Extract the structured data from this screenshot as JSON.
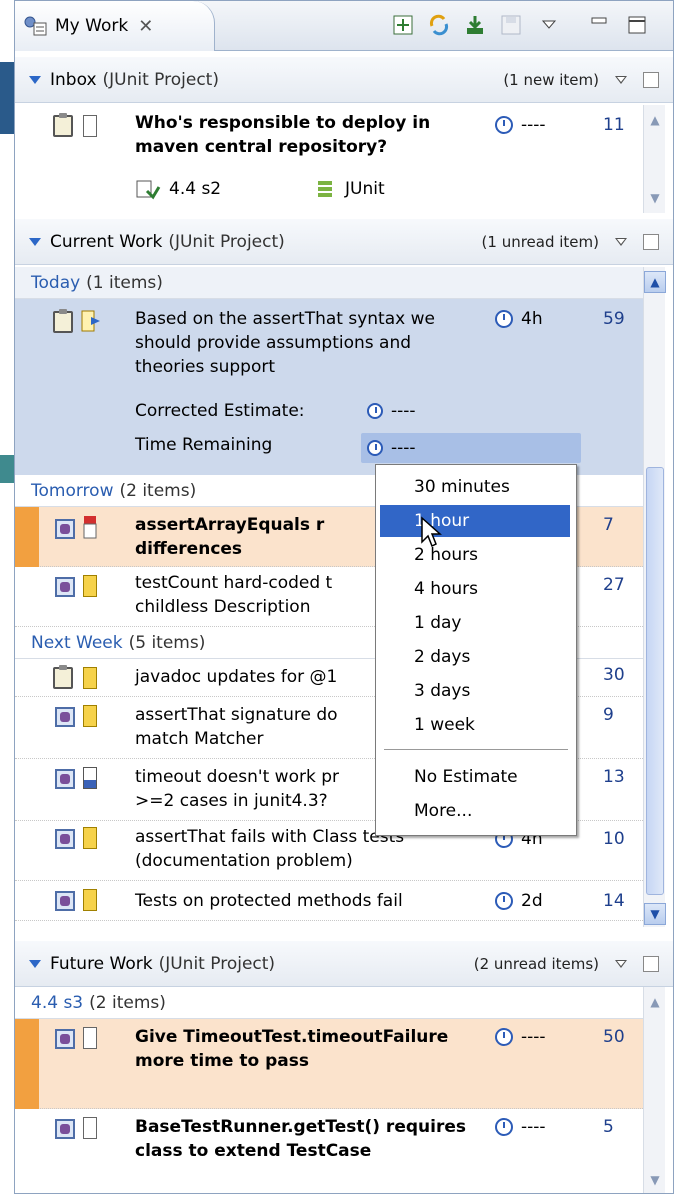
{
  "tab": {
    "label": "My Work"
  },
  "inbox": {
    "title": "Inbox",
    "project": "(JUnit Project)",
    "count": "(1 new item)",
    "row": {
      "text": "Who's responsible to deploy in maven central repository?",
      "schedule": "----",
      "id": "11",
      "release": "4.4 s2",
      "product": "JUnit"
    }
  },
  "current": {
    "title": "Current Work",
    "project": "(JUnit Project)",
    "count": "(1 unread item)",
    "today": {
      "name": "Today",
      "count": "(1 items)",
      "row": {
        "text": "Based on the assertThat syntax we should provide assumptions and theories support",
        "schedule": "4h",
        "id": "59",
        "corrected_label": "Corrected Estimate:",
        "corrected_value": "----",
        "remaining_label": "Time Remaining",
        "remaining_value": "----"
      }
    },
    "tomorrow": {
      "name": "Tomorrow",
      "count": "(2 items)",
      "rows": [
        {
          "text": "assertArrayEquals r differences",
          "id": "7"
        },
        {
          "text": "testCount hard-coded t childless Description",
          "id": "27"
        }
      ]
    },
    "nextweek": {
      "name": "Next Week",
      "count": "(5 items)",
      "rows": [
        {
          "text": "javadoc updates for @1",
          "schedule": "",
          "id": "30"
        },
        {
          "text": "assertThat signature do match Matcher",
          "schedule": "",
          "id": "9"
        },
        {
          "text": "timeout doesn't work pr >=2 cases in junit4.3?",
          "schedule": "",
          "id": "13"
        },
        {
          "text": "assertThat fails with Class tests (documentation problem)",
          "schedule": "4h",
          "id": "10"
        },
        {
          "text": "Tests on protected methods fail",
          "schedule": "2d",
          "id": "14"
        }
      ]
    }
  },
  "future": {
    "title": "Future Work",
    "project": "(JUnit Project)",
    "count": "(2 unread items)",
    "group": {
      "name": "4.4 s3",
      "count": "(2 items)"
    },
    "rows": [
      {
        "text": "Give TimeoutTest.timeoutFailure more time to pass",
        "schedule": "----",
        "id": "50"
      },
      {
        "text": "BaseTestRunner.getTest() requires class to extend TestCase",
        "schedule": "----",
        "id": "5"
      }
    ]
  },
  "dropdown": {
    "items": [
      "30 minutes",
      "1 hour",
      "2 hours",
      "4 hours",
      "1 day",
      "2 days",
      "3 days",
      "1 week"
    ],
    "extra": [
      "No Estimate",
      "More..."
    ],
    "selected": "1 hour"
  },
  "colors": {
    "accent": "#3166c7",
    "today_bg": "#cdd9ec",
    "highlight_bg": "#fbe3cc",
    "orange_bar": "#f2a040"
  }
}
